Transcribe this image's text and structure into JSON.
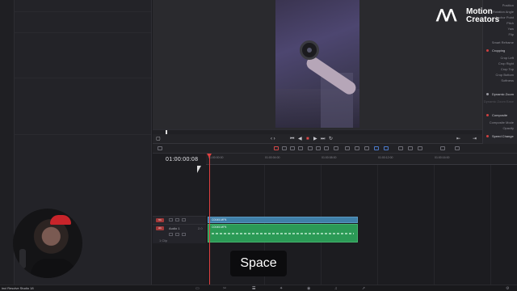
{
  "app": {
    "name": "inci Resolve Studio 18"
  },
  "inspector": {
    "items_top": [
      "Position",
      "Rotation Angle",
      "Anchor Point",
      "Pitch",
      "Yaw",
      "Flip"
    ],
    "smart_reframe": "Smart Reframe",
    "cropping": {
      "title": "Cropping",
      "items": [
        "Crop Left",
        "Crop Right",
        "Crop Top",
        "Crop Bottom",
        "Softness"
      ]
    },
    "dynamic_zoom": {
      "title": "Dynamic Zoom",
      "sub": "Dynamic Zoom Ease"
    },
    "composite": {
      "title": "Composite",
      "items": [
        "Composite Mode",
        "Opacity"
      ]
    },
    "speed_change": {
      "title": "Speed Change"
    }
  },
  "logo": {
    "line1": "Motion",
    "line2": "Creators"
  },
  "timeline": {
    "timecode": "01:00:00:08",
    "ruler_labels": [
      "01:00:00:00",
      "01:00:04:00",
      "01:00:08:00",
      "01:00:12:00",
      "01:00:16:00"
    ],
    "tracks": [
      {
        "id": "V1",
        "name": ""
      },
      {
        "id": "A1",
        "name": "Audio 1",
        "level": "2.0",
        "sub": "1 Clip"
      }
    ],
    "video_clip": {
      "name": "C0045.MP4"
    },
    "audio_clip": {
      "name": "C0045.MP4"
    }
  },
  "caption": {
    "text": "Space"
  },
  "colors": {
    "playhead": "#e04040",
    "video_clip": "#3f7fa8",
    "audio_clip": "#2b9a56",
    "caption_bg": "#0c0c0e"
  },
  "icons": [
    "play-icon",
    "stop-icon",
    "loop-icon",
    "blade-icon",
    "snap-icon",
    "link-icon",
    "flag-icon",
    "marker-icon"
  ]
}
